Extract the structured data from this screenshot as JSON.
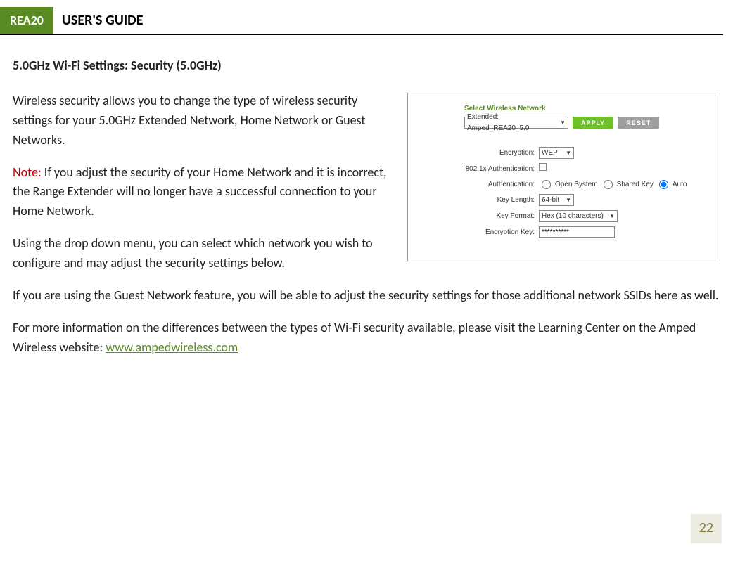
{
  "header": {
    "tab": "REA20",
    "title": "USER'S GUIDE"
  },
  "section_heading": "5.0GHz Wi-Fi Settings: Security (5.0GHz)",
  "para1": "Wireless security allows you to change the type of wireless security settings for your 5.0GHz Extended Network, Home Network or Guest Networks.",
  "note_label": "Note:",
  "para2": " If you adjust the security of your Home Network and it is incorrect, the Range Extender will no longer have a successful connection to your Home Network.",
  "para3": "Using the drop down menu, you can select which network you wish to configure and may adjust the security settings below.",
  "para4": "If you are using the Guest Network feature, you will be able to adjust the security settings for those additional network SSIDs here as well.",
  "para5_a": "For more information on the differences between the types of Wi-Fi security available, please visit the Learning Center on the Amped Wireless website: ",
  "para5_link": "www.ampedwireless.com",
  "figure": {
    "select_label": "Select Wireless Network",
    "select_value": "Extended: Amped_REA20_5.0",
    "apply": "APPLY",
    "reset": "RESET",
    "encryption_label": "Encryption:",
    "encryption_value": "WEP",
    "dot1x_label": "802.1x Authentication:",
    "auth_label": "Authentication:",
    "auth_open": "Open System",
    "auth_shared": "Shared Key",
    "auth_auto": "Auto",
    "keylen_label": "Key Length:",
    "keylen_value": "64-bit",
    "keyfmt_label": "Key Format:",
    "keyfmt_value": "Hex (10 characters)",
    "enckey_label": "Encryption Key:",
    "enckey_value": "**********"
  },
  "page_number": "22"
}
